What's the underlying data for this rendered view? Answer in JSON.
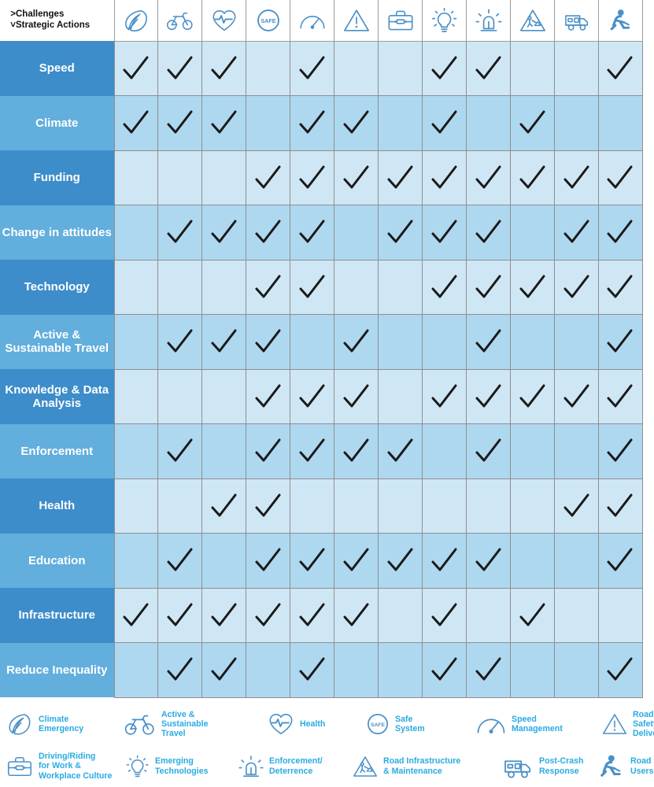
{
  "header": {
    "corner_line1": "Challenges",
    "corner_line2": "Strategic Actions",
    "corner_arrow1": ">",
    "corner_arrow2": "˅"
  },
  "colors": {
    "row_label_dark": "#3d8dca",
    "row_label_light": "#62aedd",
    "cell_dark_row": "#cfe7f5",
    "cell_light_row": "#aed8ef",
    "icon_blue": "#4a90c8",
    "legend_text": "#29abe2",
    "grid_line": "#8e8e8e",
    "check_color": "#1a1a1a"
  },
  "columns": [
    {
      "id": "climate-emergency",
      "icon": "leaf-icon",
      "label": "Climate Emergency"
    },
    {
      "id": "active-sustainable-travel",
      "icon": "bicycle-icon",
      "label": "Active & Sustainable Travel"
    },
    {
      "id": "health",
      "icon": "heart-pulse-icon",
      "label": "Health"
    },
    {
      "id": "safe-system",
      "icon": "safe-badge-icon",
      "label": "Safe System"
    },
    {
      "id": "speed-management",
      "icon": "speedometer-icon",
      "label": "Speed Management"
    },
    {
      "id": "road-safety-delivery",
      "icon": "warning-triangle-icon",
      "label": "Road Safety Delivery"
    },
    {
      "id": "driving-riding-work",
      "icon": "briefcase-icon",
      "label": "Driving/Riding for Work & Workplace Culture"
    },
    {
      "id": "emerging-technologies",
      "icon": "lightbulb-icon",
      "label": "Emerging Technologies"
    },
    {
      "id": "enforcement-deterrence",
      "icon": "siren-icon",
      "label": "Enforcement/Deterrence"
    },
    {
      "id": "road-infrastructure",
      "icon": "roadworks-triangle-icon",
      "label": "Road Infrastructure & Maintenance"
    },
    {
      "id": "post-crash-response",
      "icon": "ambulance-icon",
      "label": "Post-Crash Response"
    },
    {
      "id": "road-users",
      "icon": "road-user-icon",
      "label": "Road Users"
    }
  ],
  "rows": [
    {
      "label": "Speed",
      "shade": "dark",
      "checks": [
        1,
        1,
        1,
        0,
        1,
        0,
        0,
        1,
        1,
        0,
        0,
        1
      ]
    },
    {
      "label": "Climate",
      "shade": "light",
      "checks": [
        1,
        1,
        1,
        0,
        1,
        1,
        0,
        1,
        0,
        1,
        0,
        0
      ]
    },
    {
      "label": "Funding",
      "shade": "dark",
      "checks": [
        0,
        0,
        0,
        1,
        1,
        1,
        1,
        1,
        1,
        1,
        1,
        1
      ]
    },
    {
      "label": "Change in attitudes",
      "shade": "light",
      "checks": [
        0,
        1,
        1,
        1,
        1,
        0,
        1,
        1,
        1,
        0,
        1,
        1
      ]
    },
    {
      "label": "Technology",
      "shade": "dark",
      "checks": [
        0,
        0,
        0,
        1,
        1,
        0,
        0,
        1,
        1,
        1,
        1,
        1
      ]
    },
    {
      "label": "Active & Sustainable Travel",
      "shade": "light",
      "checks": [
        0,
        1,
        1,
        1,
        0,
        1,
        0,
        0,
        1,
        0,
        0,
        1
      ]
    },
    {
      "label": "Knowledge & Data Analysis",
      "shade": "dark",
      "checks": [
        0,
        0,
        0,
        1,
        1,
        1,
        0,
        1,
        1,
        1,
        1,
        1
      ]
    },
    {
      "label": "Enforcement",
      "shade": "light",
      "checks": [
        0,
        1,
        0,
        1,
        1,
        1,
        1,
        0,
        1,
        0,
        0,
        1
      ]
    },
    {
      "label": "Health",
      "shade": "dark",
      "checks": [
        0,
        0,
        1,
        1,
        0,
        0,
        0,
        0,
        0,
        0,
        1,
        1
      ]
    },
    {
      "label": "Education",
      "shade": "light",
      "checks": [
        0,
        1,
        0,
        1,
        1,
        1,
        1,
        1,
        1,
        0,
        0,
        1
      ]
    },
    {
      "label": "Infrastructure",
      "shade": "dark",
      "checks": [
        1,
        1,
        1,
        1,
        1,
        1,
        0,
        1,
        0,
        1,
        0,
        0
      ]
    },
    {
      "label": "Reduce Inequality",
      "shade": "light",
      "checks": [
        0,
        1,
        1,
        0,
        1,
        0,
        0,
        1,
        1,
        0,
        0,
        1
      ]
    }
  ],
  "legend": [
    {
      "icon": "leaf-icon",
      "label": "Climate\nEmergency"
    },
    {
      "icon": "bicycle-icon",
      "label": "Active &\nSustainable\nTravel"
    },
    {
      "icon": "heart-pulse-icon",
      "label": "Health"
    },
    {
      "icon": "safe-badge-icon",
      "label": "Safe\nSystem"
    },
    {
      "icon": "speedometer-icon",
      "label": "Speed\nManagement"
    },
    {
      "icon": "warning-triangle-icon",
      "label": "Road\nSafety\nDelivery"
    },
    {
      "icon": "briefcase-icon",
      "label": "Driving/Riding\nfor Work &\nWorkplace Culture"
    },
    {
      "icon": "lightbulb-icon",
      "label": "Emerging\nTechnologies"
    },
    {
      "icon": "siren-icon",
      "label": "Enforcement/\nDeterrence"
    },
    {
      "icon": "roadworks-triangle-icon",
      "label": "Road Infrastructure\n& Maintenance"
    },
    {
      "icon": "ambulance-icon",
      "label": "Post-Crash\nResponse"
    },
    {
      "icon": "road-user-icon",
      "label": "Road\nUsers"
    }
  ]
}
